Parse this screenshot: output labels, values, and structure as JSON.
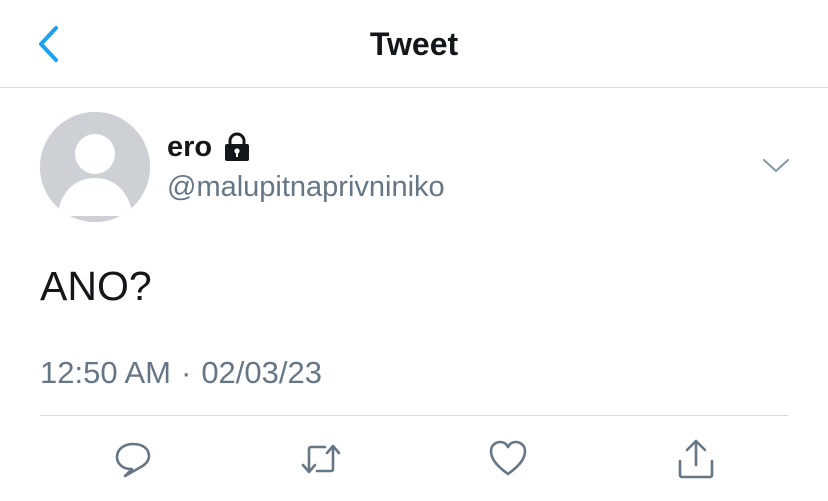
{
  "header": {
    "back_icon": "chevron-left-icon",
    "title": "Tweet"
  },
  "tweet": {
    "author_name": "ero",
    "protected_icon": "lock-icon",
    "author_handle": "@malupitnaprivniniko",
    "more_icon": "chevron-down-icon",
    "text": "ANO?",
    "time": "12:50 AM",
    "separator": "·",
    "date": "02/03/23"
  },
  "actions": [
    {
      "name": "reply",
      "icon": "reply-icon"
    },
    {
      "name": "retweet",
      "icon": "retweet-icon"
    },
    {
      "name": "like",
      "icon": "heart-icon"
    },
    {
      "name": "share",
      "icon": "share-icon"
    }
  ],
  "colors": {
    "accent": "#1da1f2",
    "secondary_text": "#657786",
    "icon_gray": "#657786",
    "divider": "#d6d9dc",
    "avatar_bg": "#cdd1d6"
  }
}
